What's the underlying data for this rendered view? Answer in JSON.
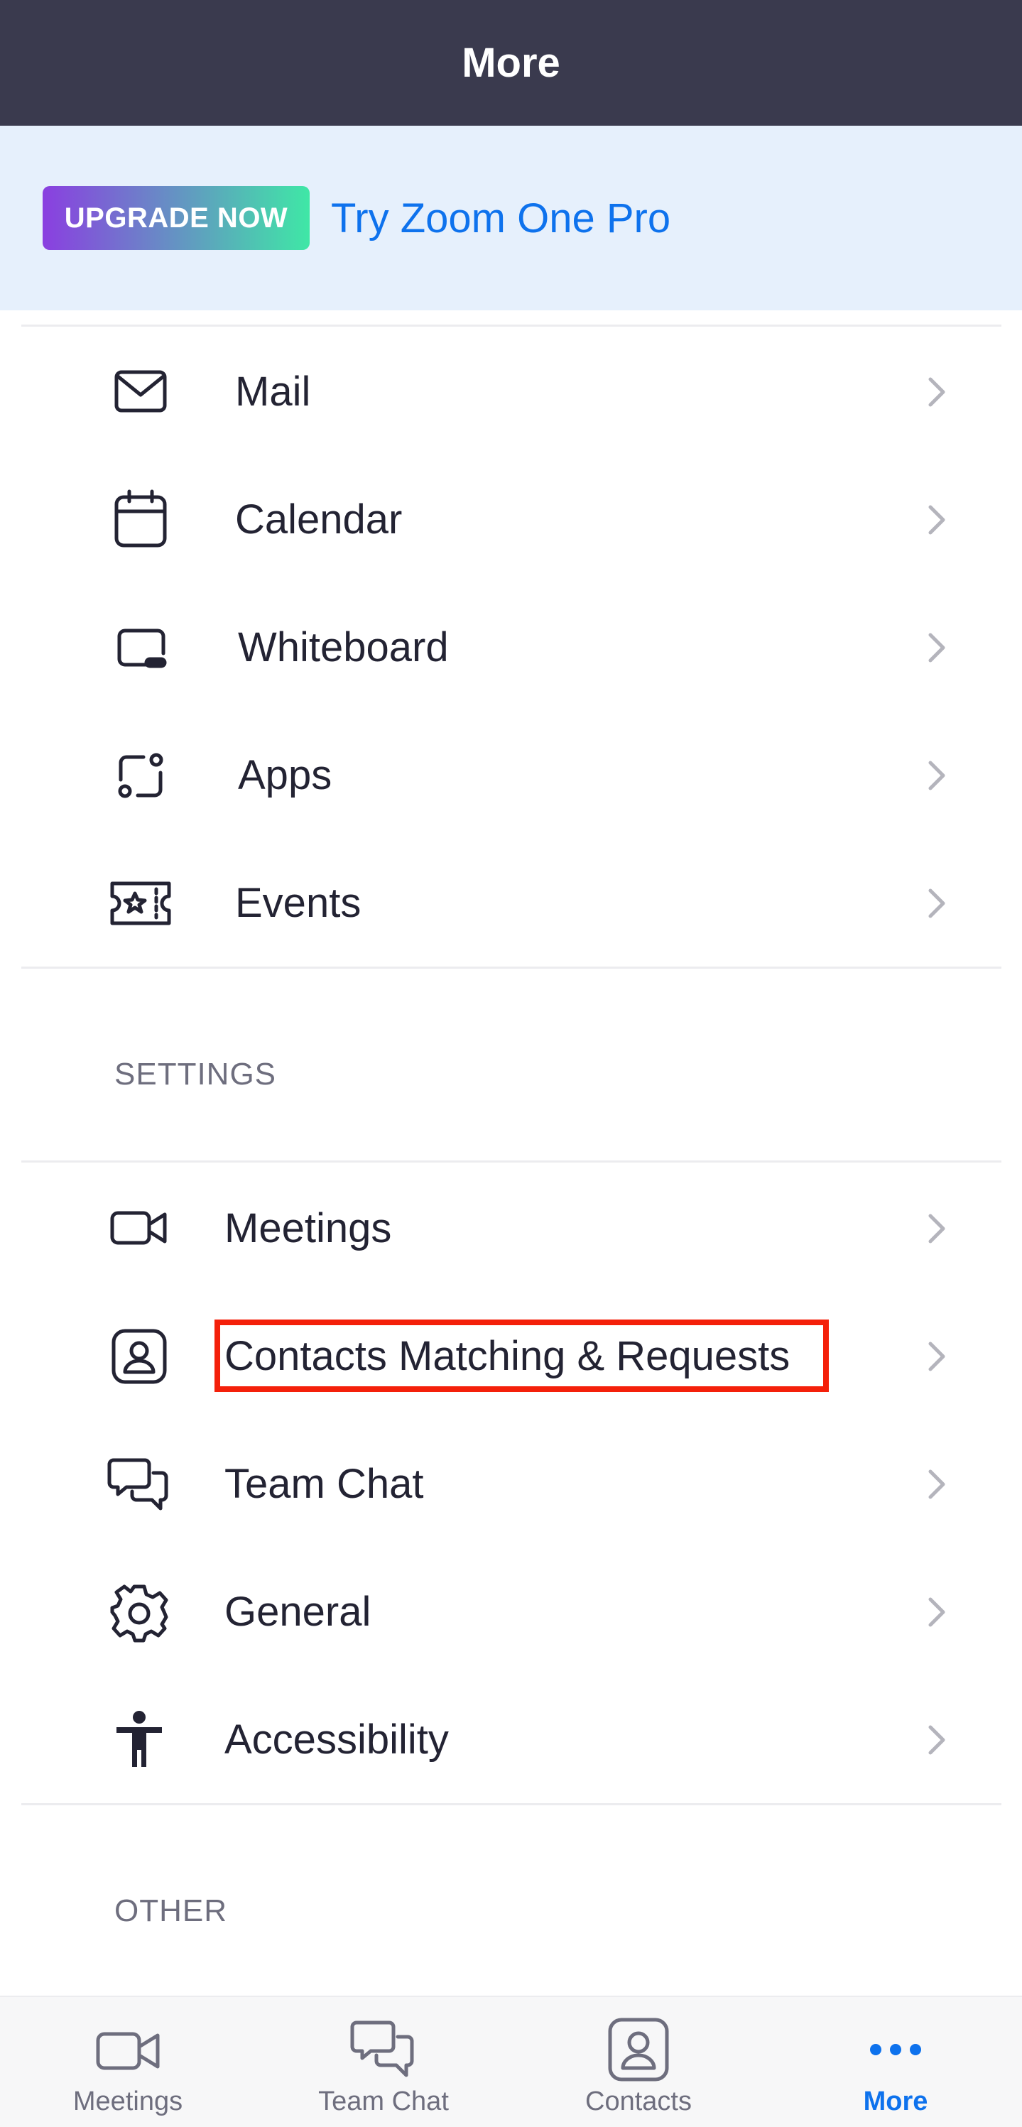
{
  "header": {
    "title": "More"
  },
  "banner": {
    "upgrade_label": "UPGRADE NOW",
    "link_text": "Try Zoom One Pro"
  },
  "features": [
    {
      "label": "Mail",
      "icon": "mail-icon"
    },
    {
      "label": "Calendar",
      "icon": "calendar-icon"
    },
    {
      "label": "Whiteboard",
      "icon": "whiteboard-icon"
    },
    {
      "label": "Apps",
      "icon": "apps-icon"
    },
    {
      "label": "Events",
      "icon": "events-icon"
    }
  ],
  "settings": {
    "title": "SETTINGS",
    "items": [
      {
        "label": "Meetings",
        "icon": "video-camera-icon"
      },
      {
        "label": "Contacts Matching & Requests",
        "icon": "contact-card-icon"
      },
      {
        "label": "Team Chat",
        "icon": "chat-bubbles-icon"
      },
      {
        "label": "General",
        "icon": "gear-icon"
      },
      {
        "label": "Accessibility",
        "icon": "accessibility-icon"
      }
    ]
  },
  "other": {
    "title": "OTHER"
  },
  "tabbar": {
    "tabs": [
      {
        "label": "Meetings",
        "icon": "video-camera-icon",
        "active": false
      },
      {
        "label": "Team Chat",
        "icon": "chat-bubbles-icon",
        "active": false
      },
      {
        "label": "Contacts",
        "icon": "contact-card-icon",
        "active": false
      },
      {
        "label": "More",
        "icon": "more-dots-icon",
        "active": true
      }
    ]
  },
  "colors": {
    "header_bg": "#3a3a4e",
    "accent": "#0e72ed",
    "banner_bg": "#e6f0fc",
    "highlight": "#f4200a"
  }
}
